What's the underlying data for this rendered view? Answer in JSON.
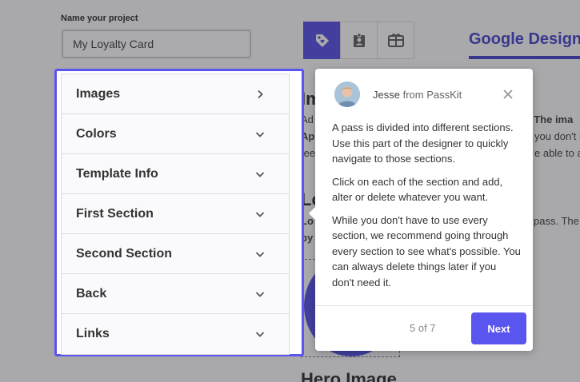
{
  "project": {
    "label": "Name your project",
    "value": "My Loyalty Card"
  },
  "pass_type_tabs": [
    {
      "icon": "tag-icon",
      "active": true
    },
    {
      "icon": "id-badge-icon",
      "active": false
    },
    {
      "icon": "gift-card-icon",
      "active": false
    }
  ],
  "design_tab": {
    "label": "Google Design"
  },
  "background_content": {
    "images_heading": "Im",
    "images_text_1": "Ad",
    "images_text_1_right": ". The ima",
    "images_text_2": "Ap",
    "images_text_2_right": "you don't h",
    "images_text_3": "tee",
    "images_text_3_right": "e able to a",
    "logo_heading": "Lo",
    "logo_text_1": "Lo",
    "logo_text_1_right": "pass. The",
    "logo_text_2": "by",
    "hero_heading": "Hero Image"
  },
  "section_nav": {
    "items": [
      {
        "label": "Images",
        "chevron": "chevron-right-icon"
      },
      {
        "label": "Colors",
        "chevron": "chevron-down-icon"
      },
      {
        "label": "Template Info",
        "chevron": "chevron-down-icon"
      },
      {
        "label": "First Section",
        "chevron": "chevron-down-icon"
      },
      {
        "label": "Second Section",
        "chevron": "chevron-down-icon"
      },
      {
        "label": "Back",
        "chevron": "chevron-down-icon"
      },
      {
        "label": "Links",
        "chevron": "chevron-down-icon"
      }
    ]
  },
  "tour": {
    "author_name": "Jesse",
    "author_from": "from PassKit",
    "paragraphs": [
      "A pass is divided into different sections. Use this part of the designer to quickly navigate to those sections.",
      "Click on each of the section and add, alter or delete whatever you want.",
      "While you don't have to use every section, we recommend going through every section to see what's possible.  You can always delete things later if you don't need it."
    ],
    "step": "5 of 7",
    "next_label": "Next"
  },
  "colors": {
    "accent": "#5b55f0",
    "brand_dark": "#3c37c8",
    "overlay": "rgba(55,55,60,0.42)"
  }
}
